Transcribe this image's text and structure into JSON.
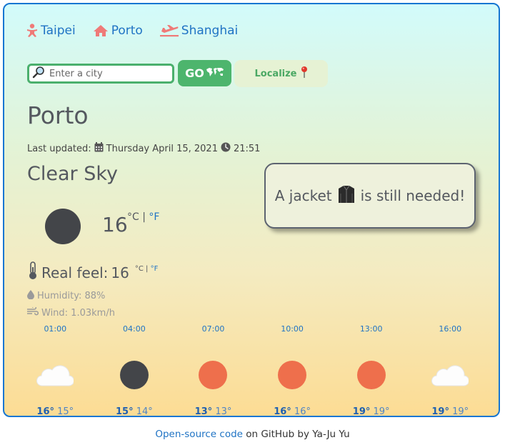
{
  "cities": [
    {
      "label": "Taipei",
      "icon": "baby-icon"
    },
    {
      "label": "Porto",
      "icon": "home-icon"
    },
    {
      "label": "Shanghai",
      "icon": "plane-icon"
    }
  ],
  "search": {
    "placeholder": "Enter a city",
    "value": ""
  },
  "go_label": "GO",
  "localize_label": "Localize",
  "city_name": "Porto",
  "last_updated_label": "Last updated:",
  "date": "Thursday April 15, 2021",
  "time": "21:51",
  "description": "Clear Sky",
  "advice": {
    "before": "A jacket",
    "after": "is still needed!"
  },
  "temperature": "16",
  "unit_c": "°C",
  "unit_sep": "|",
  "unit_f": "°F",
  "real_feel_label": "Real feel:",
  "real_feel_value": "16",
  "humidity": "Humidity: 88%",
  "wind": "Wind: 1.03km/h",
  "forecast": [
    {
      "time": "01:00",
      "icon": "cloud-icon",
      "max": "16°",
      "min": "15°"
    },
    {
      "time": "04:00",
      "icon": "moon-icon",
      "max": "15°",
      "min": "14°"
    },
    {
      "time": "07:00",
      "icon": "sun-icon",
      "max": "13°",
      "min": "13°"
    },
    {
      "time": "10:00",
      "icon": "sun-icon",
      "max": "16°",
      "min": "16°"
    },
    {
      "time": "13:00",
      "icon": "sun-icon",
      "max": "19°",
      "min": "19°"
    },
    {
      "time": "16:00",
      "icon": "cloud-icon",
      "max": "19°",
      "min": "19°"
    }
  ],
  "footer": {
    "link": "Open-source code",
    "rest": "on GitHub by Ya-Ju Yu"
  },
  "colors": {
    "accent": "#1f73c4",
    "green": "#4db56d",
    "sun": "#ee6f4c",
    "moon": "#434549",
    "border": "#1676d2"
  }
}
